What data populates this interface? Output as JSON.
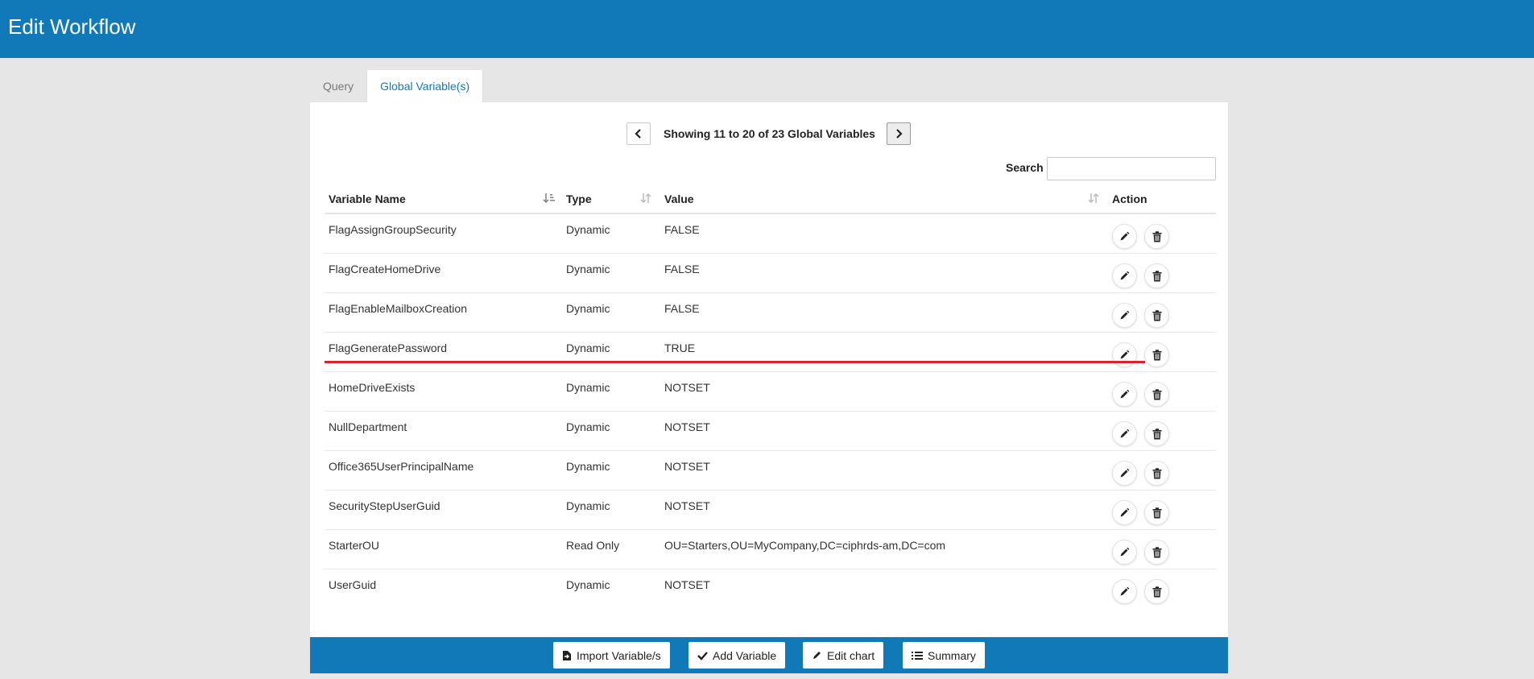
{
  "header": {
    "title": "Edit Workflow"
  },
  "tabs": [
    {
      "label": "Query",
      "active": false
    },
    {
      "label": "Global Variable(s)",
      "active": true
    }
  ],
  "pager": {
    "text": "Showing 11 to 20 of 23 Global Variables"
  },
  "search": {
    "label": "Search",
    "value": ""
  },
  "table": {
    "headers": {
      "name": "Variable Name",
      "type": "Type",
      "value": "Value",
      "action": "Action"
    },
    "rows": [
      {
        "name": "FlagAssignGroupSecurity",
        "type": "Dynamic",
        "value": "FALSE"
      },
      {
        "name": "FlagCreateHomeDrive",
        "type": "Dynamic",
        "value": "FALSE"
      },
      {
        "name": "FlagEnableMailboxCreation",
        "type": "Dynamic",
        "value": "FALSE"
      },
      {
        "name": "FlagGeneratePassword",
        "type": "Dynamic",
        "value": "TRUE"
      },
      {
        "name": "HomeDriveExists",
        "type": "Dynamic",
        "value": "NOTSET"
      },
      {
        "name": "NullDepartment",
        "type": "Dynamic",
        "value": "NOTSET"
      },
      {
        "name": "Office365UserPrincipalName",
        "type": "Dynamic",
        "value": "NOTSET"
      },
      {
        "name": "SecurityStepUserGuid",
        "type": "Dynamic",
        "value": "NOTSET"
      },
      {
        "name": "StarterOU",
        "type": "Read Only",
        "value": "OU=Starters,OU=MyCompany,DC=ciphrds-am,DC=com"
      },
      {
        "name": "UserGuid",
        "type": "Dynamic",
        "value": "NOTSET"
      }
    ]
  },
  "footer": {
    "import_label": "Import Variable/s",
    "add_label": "Add Variable",
    "chart_label": "Edit chart",
    "summary_label": "Summary"
  },
  "colors": {
    "brand": "#1279b8",
    "highlight_line": "#d9232e"
  }
}
